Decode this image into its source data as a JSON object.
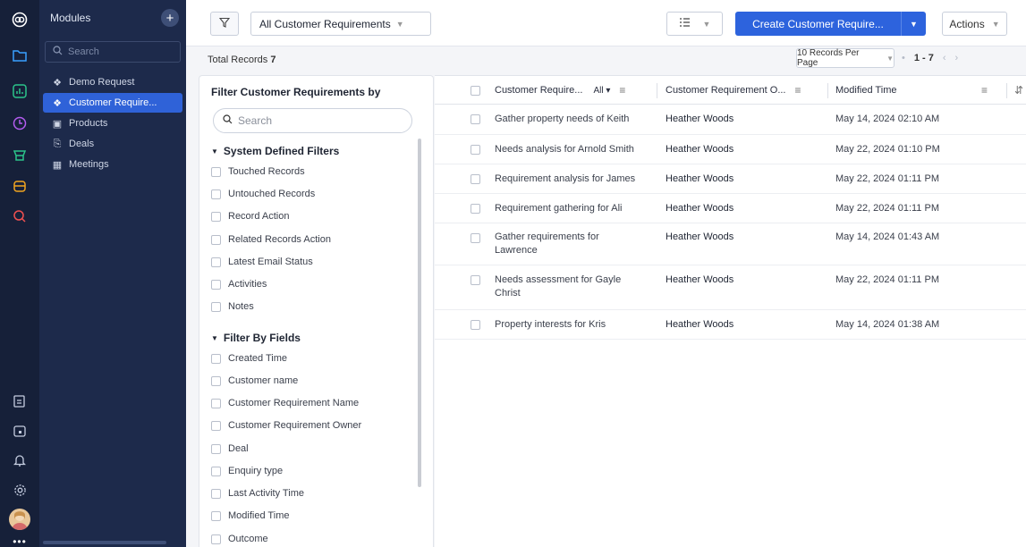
{
  "rail": {
    "icons": [
      "home-icon",
      "folder-icon",
      "analytics-icon",
      "clock-icon",
      "leads-icon",
      "store-icon",
      "search-circle-icon",
      "tasks-icon",
      "calendar-icon",
      "bell-icon",
      "settings-icon",
      "avatar",
      "more-icon"
    ]
  },
  "sidebar": {
    "title": "Modules",
    "search_placeholder": "Search",
    "items": [
      {
        "label": "Demo Request",
        "icon": "module-icon",
        "active": false
      },
      {
        "label": "Customer Require...",
        "icon": "module-icon",
        "active": true
      },
      {
        "label": "Products",
        "icon": "box-icon",
        "active": false
      },
      {
        "label": "Deals",
        "icon": "deal-icon",
        "active": false
      },
      {
        "label": "Meetings",
        "icon": "calendar-icon",
        "active": false
      }
    ]
  },
  "toolbar": {
    "view_label": "All Customer Requirements",
    "create_label": "Create Customer Require...",
    "actions_label": "Actions"
  },
  "subbar": {
    "total_label": "Total Records",
    "total_count": "7",
    "per_page": "10 Records Per Page",
    "range": "1 - 7"
  },
  "filters": {
    "title": "Filter Customer Requirements by",
    "search_placeholder": "Search",
    "system_title": "System Defined Filters",
    "system": [
      "Touched Records",
      "Untouched Records",
      "Record Action",
      "Related Records Action",
      "Latest Email Status",
      "Activities",
      "Notes"
    ],
    "fields_title": "Filter By Fields",
    "fields": [
      "Created Time",
      "Customer name",
      "Customer Requirement Name",
      "Customer Requirement Owner",
      "Deal",
      "Enquiry type",
      "Last Activity Time",
      "Modified Time",
      "Outcome"
    ]
  },
  "table": {
    "columns": {
      "name": "Customer Require...",
      "all": "All",
      "owner": "Customer Requirement O...",
      "modified": "Modified Time"
    },
    "rows": [
      {
        "name": "Gather property needs of Keith",
        "owner": "Heather Woods",
        "modified": "May 14, 2024 02:10 AM"
      },
      {
        "name": "Needs analysis for Arnold Smith",
        "owner": "Heather Woods",
        "modified": "May 22, 2024 01:10 PM"
      },
      {
        "name": "Requirement analysis for James",
        "owner": "Heather Woods",
        "modified": "May 22, 2024 01:11 PM"
      },
      {
        "name": "Requirement gathering for Ali",
        "owner": "Heather Woods",
        "modified": "May 22, 2024 01:11 PM"
      },
      {
        "name": "Gather requirements for Lawrence",
        "owner": "Heather Woods",
        "modified": "May 14, 2024 01:43 AM"
      },
      {
        "name": "Needs assessment for Gayle Christ",
        "owner": "Heather Woods",
        "modified": "May 22, 2024 01:11 PM"
      },
      {
        "name": "Property interests for Kris",
        "owner": "Heather Woods",
        "modified": "May 14, 2024 01:38 AM"
      }
    ]
  },
  "colors": {
    "rail": "#162039",
    "sidebar": "#1d2a4b",
    "accent": "#2d63dd"
  }
}
